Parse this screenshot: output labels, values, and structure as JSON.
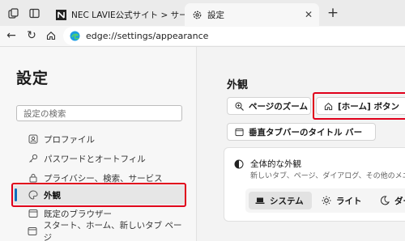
{
  "tabs": [
    {
      "title": "NEC LAVIE公式サイト > サービス&サ"
    },
    {
      "title": "設定"
    }
  ],
  "toolbar": {
    "url": "edge://settings/appearance"
  },
  "sidebar": {
    "title": "設定",
    "search_placeholder": "設定の検索",
    "items": [
      {
        "label": "プロファイル"
      },
      {
        "label": "パスワードとオートフィル"
      },
      {
        "label": "プライバシー、検索、サービス"
      },
      {
        "label": "外観"
      },
      {
        "label": "既定のブラウザー"
      },
      {
        "label": "スタート、ホーム、新しいタブ ページ"
      }
    ]
  },
  "main": {
    "section_title": "外観",
    "buttons": [
      {
        "label": "ページのズーム"
      },
      {
        "label": "[ホーム] ボタン"
      },
      {
        "label": "垂直タブバーのタイトル バー"
      }
    ],
    "theme": {
      "title": "全体的な外観",
      "desc": "新しいタブ、ページ、ダイアログ、その他のメニュー",
      "options": [
        {
          "label": "システム"
        },
        {
          "label": "ライト"
        },
        {
          "label": "ダーク"
        }
      ]
    }
  },
  "colors": {
    "highlight": "#e0001b",
    "accent": "#0f6cbd"
  }
}
